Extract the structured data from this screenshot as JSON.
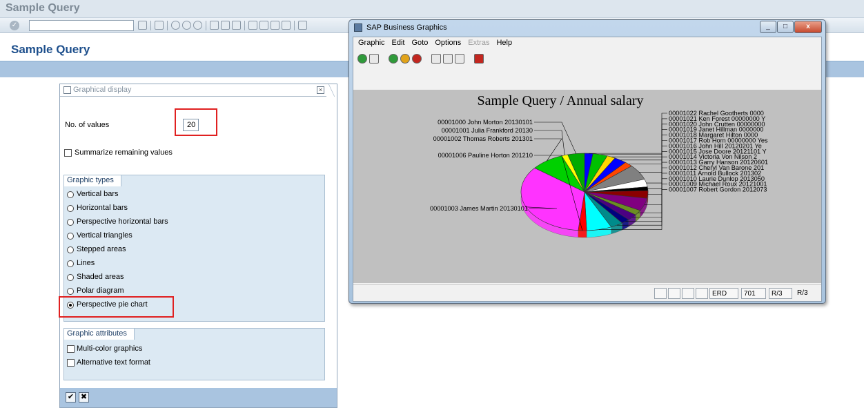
{
  "main": {
    "window_title": "Sample Query",
    "command_field": "",
    "app_title": "Sample Query"
  },
  "panel": {
    "header": "Graphical display",
    "num_values_label": "No. of values",
    "num_values": "20",
    "summarize_label": "Summarize remaining values",
    "summarize_checked": false,
    "graphic_types_title": "Graphic types",
    "graphic_types": [
      "Vertical bars",
      "Horizontal bars",
      "Perspective horizontal bars",
      "Vertical triangles",
      "Stepped areas",
      "Lines",
      "Shaded areas",
      "Polar diagram",
      "Perspective pie chart"
    ],
    "selected_graphic_type": "Perspective pie chart",
    "attributes_title": "Graphic attributes",
    "attributes": [
      "Multi-color graphics",
      "Alternative text format"
    ]
  },
  "graphics_window": {
    "title": "SAP Business Graphics",
    "menu": [
      "Graphic",
      "Edit",
      "Goto",
      "Options",
      "Extras",
      "Help"
    ],
    "disabled_menu": [
      "Extras"
    ],
    "status": [
      "ERD",
      "701",
      "R/3",
      "R/3"
    ]
  },
  "chart_data": {
    "type": "pie",
    "title": "Sample Query / Annual salary",
    "slices": [
      {
        "label": "00001022 Rachel Gootherts 0000",
        "color": "#0000ff",
        "value": 2.0
      },
      {
        "label": "00001021 Ken Forest 00000000 Y",
        "color": "#00c000",
        "value": 3.5
      },
      {
        "label": "00001020 John Crutten 00000000",
        "color": "#ffd700",
        "value": 2.0
      },
      {
        "label": "00001019 Janet Hillman 0000000",
        "color": "#0000ff",
        "value": 3.0
      },
      {
        "label": "00001018 Margaret Hilton 0000",
        "color": "#ff4500",
        "value": 2.0
      },
      {
        "label": "00001017 Rob Horn 00000000 Yes",
        "color": "#808080",
        "value": 6.0
      },
      {
        "label": "00001016 John Hill 20120201 Ye",
        "color": "#ffffff",
        "value": 3.0
      },
      {
        "label": "00001015 Jose Doore 20121101 Y",
        "color": "#000000",
        "value": 1.5
      },
      {
        "label": "00001014 Victoria Von Nilson 2",
        "color": "#8b0000",
        "value": 3.0
      },
      {
        "label": "00001013 Garry Hanson 20120601",
        "color": "#800080",
        "value": 5.0
      },
      {
        "label": "00001012 Cheryl Van Barone 201",
        "color": "#6b8e23",
        "value": 2.0
      },
      {
        "label": "00001011 Arnold Bullock 201302",
        "color": "#4b0082",
        "value": 2.5
      },
      {
        "label": "00001010 Laurie Dunlop 2013050",
        "color": "#000080",
        "value": 2.0
      },
      {
        "label": "00001009 Michael Roux 20121001",
        "color": "#008b8b",
        "value": 3.0
      },
      {
        "label": "00001007 Robert Gordon 2012073",
        "color": "#00ffff",
        "value": 6.0
      },
      {
        "label": "00001006 Pauline Horton 201210",
        "color": "#ff0000",
        "value": 2.0
      },
      {
        "label": "00001003 James Martin 20130101",
        "color": "#ff33ff",
        "value": 32.0
      },
      {
        "label": "00001002 Thomas Roberts 201301",
        "color": "#00d000",
        "value": 8.0
      },
      {
        "label": "00001001 Julia Frankford 20130",
        "color": "#ffff00",
        "value": 1.5
      },
      {
        "label": "00001000 John Morton 20130101",
        "color": "#00aa00",
        "value": 4.0
      }
    ]
  }
}
